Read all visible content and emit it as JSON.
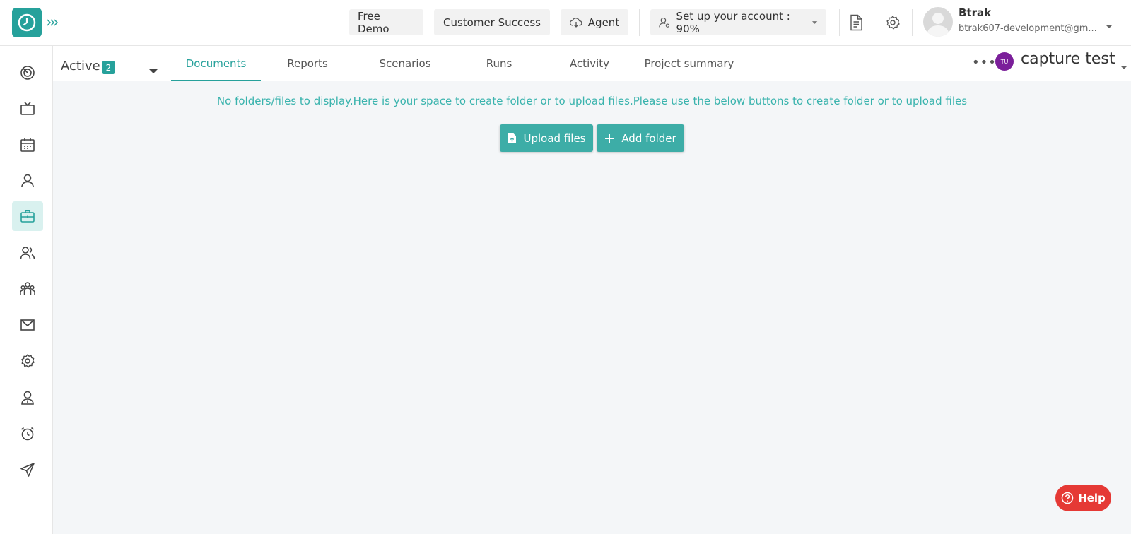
{
  "header": {
    "free_demo": "Free Demo",
    "customer_success": "Customer Success",
    "agent": "Agent",
    "setup_account": "Set up your account : 90%",
    "user_name": "Btrak",
    "user_email": "btrak607-development@gm..."
  },
  "subnav": {
    "status_label": "Active",
    "status_count": "2",
    "tabs": [
      {
        "label": "Documents",
        "active": true
      },
      {
        "label": "Reports",
        "active": false
      },
      {
        "label": "Scenarios",
        "active": false
      },
      {
        "label": "Runs",
        "active": false
      },
      {
        "label": "Activity",
        "active": false
      },
      {
        "label": "Project summary",
        "active": false
      }
    ],
    "project_initials": "TU",
    "project_name": "capture test"
  },
  "main": {
    "empty_message": "No folders/files to display.Here is your space to create folder or to upload files.Please use the below buttons to create folder or to upload files",
    "upload_label": "Upload files",
    "add_folder_label": "Add folder"
  },
  "help": {
    "label": "Help"
  },
  "sidebar": {
    "items": [
      {
        "icon": "dashboard-icon"
      },
      {
        "icon": "tv-icon"
      },
      {
        "icon": "calendar-icon"
      },
      {
        "icon": "user-icon"
      },
      {
        "icon": "briefcase-icon",
        "active": true
      },
      {
        "icon": "users-icon"
      },
      {
        "icon": "team-icon"
      },
      {
        "icon": "mail-icon"
      },
      {
        "icon": "settings-icon"
      },
      {
        "icon": "badge-user-icon"
      },
      {
        "icon": "alarm-icon"
      },
      {
        "icon": "send-icon"
      }
    ]
  },
  "colors": {
    "brand": "#26a19b",
    "help": "#e53935",
    "project_badge": "#7b1f9a"
  }
}
